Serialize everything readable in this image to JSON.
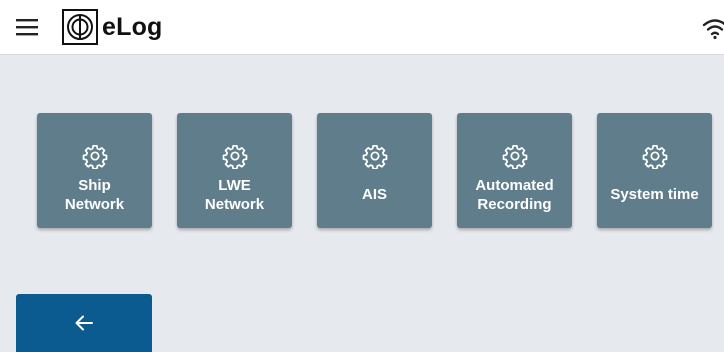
{
  "header": {
    "menu_icon": "hamburger-menu-icon",
    "logo_icon": "elog-logo-mark",
    "app_title": "eLog",
    "status_icon": "wifi-icon"
  },
  "settings": {
    "tiles": [
      {
        "label": "Ship\nNetwork",
        "icon": "gear-icon"
      },
      {
        "label": "LWE\nNetwork",
        "icon": "gear-icon"
      },
      {
        "label": "AIS",
        "icon": "gear-icon"
      },
      {
        "label": "Automated\nRecording",
        "icon": "gear-icon"
      },
      {
        "label": "System time",
        "icon": "gear-icon"
      }
    ]
  },
  "footer": {
    "back_icon": "arrow-left-icon"
  },
  "colors": {
    "background": "#e6eaef",
    "header": "#ffffff",
    "tile": "#607d8b",
    "back_button": "#0b5a90"
  }
}
